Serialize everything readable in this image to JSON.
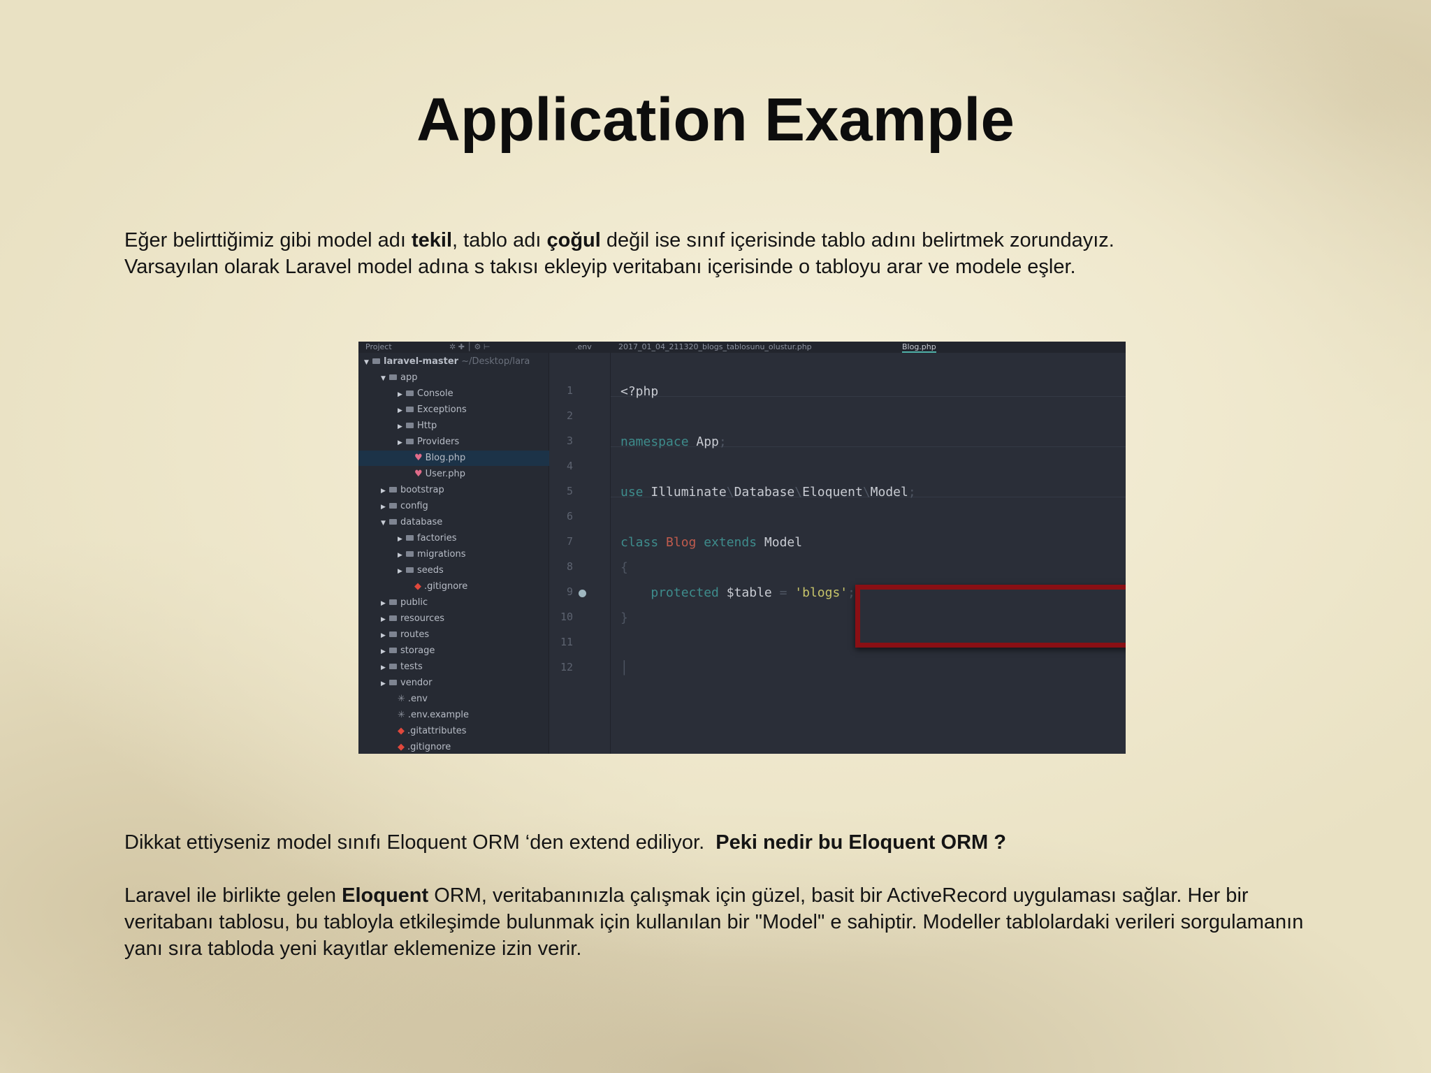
{
  "slide": {
    "title": "Application Example",
    "intro": {
      "line1_before_tekil": "Eğer belirttiğimiz gibi model adı ",
      "tekil": "tekil",
      "line1_mid": ", tablo adı ",
      "cogul": "çoğul",
      "line1_after": " değil ise sınıf içerisinde tablo adını belirtmek zorundayız.",
      "line2": "Varsayılan olarak Laravel model adına s takısı ekleyip veritabanı içerisinde o tabloyu arar ve modele eşler."
    },
    "question": {
      "text": "Dikkat ettiyseniz model sınıfı Eloquent ORM ‘den extend ediliyor.  ",
      "bold": "Peki nedir bu Eloquent ORM ?"
    },
    "description": {
      "before": "Laravel ile birlikte gelen ",
      "bold": "Eloquent",
      "after": " ORM, veritabanınızla çalışmak için güzel, basit bir ActiveRecord uygulaması sağlar. Her bir veritabanı tablosu, bu tabloyla etkileşimde bulunmak için kullanılan bir \"Model\" e sahiptir. Modeller tablolardaki verileri sorgulamanın yanı sıra tabloda yeni kayıtlar eklemenize izin verir."
    }
  },
  "ide": {
    "tabs": {
      "project": "Project",
      "env": ".env",
      "migration": "2017_01_04_211320_blogs_tablosunu_olustur.php",
      "blog": "Blog.php"
    },
    "tree": [
      {
        "label": "laravel-master",
        "suffix": " ~/Desktop/lara",
        "kind": "folder",
        "open": true
      },
      {
        "label": "app",
        "kind": "folder",
        "open": true
      },
      {
        "label": "Console",
        "kind": "folder",
        "open": false
      },
      {
        "label": "Exceptions",
        "kind": "folder",
        "open": false
      },
      {
        "label": "Http",
        "kind": "folder",
        "open": false
      },
      {
        "label": "Providers",
        "kind": "folder",
        "open": false
      },
      {
        "label": "Blog.php",
        "kind": "php",
        "selected": true
      },
      {
        "label": "User.php",
        "kind": "php"
      },
      {
        "label": "bootstrap",
        "kind": "folder",
        "open": false
      },
      {
        "label": "config",
        "kind": "folder",
        "open": false
      },
      {
        "label": "database",
        "kind": "folder",
        "open": true
      },
      {
        "label": "factories",
        "kind": "folder",
        "open": false
      },
      {
        "label": "migrations",
        "kind": "folder",
        "open": false
      },
      {
        "label": "seeds",
        "kind": "folder",
        "open": false
      },
      {
        "label": ".gitignore",
        "kind": "git"
      },
      {
        "label": "public",
        "kind": "folder",
        "open": false
      },
      {
        "label": "resources",
        "kind": "folder",
        "open": false
      },
      {
        "label": "routes",
        "kind": "folder",
        "open": false
      },
      {
        "label": "storage",
        "kind": "folder",
        "open": false
      },
      {
        "label": "tests",
        "kind": "folder",
        "open": false
      },
      {
        "label": "vendor",
        "kind": "folder",
        "open": false
      },
      {
        "label": ".env",
        "kind": "env"
      },
      {
        "label": ".env.example",
        "kind": "env"
      },
      {
        "label": ".gitattributes",
        "kind": "git"
      },
      {
        "label": ".gitignore",
        "kind": "git"
      }
    ],
    "line_numbers": [
      "1",
      "2",
      "3",
      "4",
      "5",
      "6",
      "7",
      "8",
      "9",
      "10",
      "11",
      "12"
    ],
    "code": {
      "l1": "<?php",
      "l3_kw": "namespace",
      "l3_rest": " App",
      "l5_kw": "use",
      "l5_a": " Illuminate",
      "l5_b": "Database",
      "l5_c": "Eloquent",
      "l5_d": "Model",
      "l7_kw1": "class",
      "l7_cls": " Blog",
      "l7_kw2": " extends",
      "l7_rest": " Model",
      "l8": "{",
      "l9_kw": "protected",
      "l9_var": " $table",
      "l9_eq": " = ",
      "l9_str": "'blogs'",
      "l9_semi": ";",
      "l10": "}"
    },
    "colors": {
      "background": "#2a2e38",
      "keyword": "#3e8c8c",
      "class_name": "#c05b4d",
      "string": "#c7c46a",
      "highlight_box": "#8a0f14"
    }
  }
}
